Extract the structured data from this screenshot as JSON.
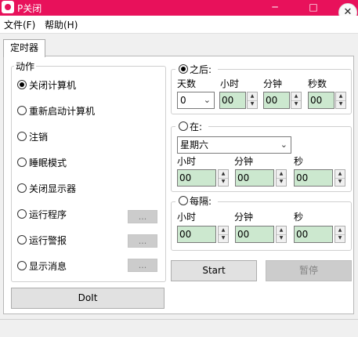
{
  "window": {
    "title": "P关闭",
    "min_glyph": "─",
    "max_glyph": "□",
    "close_glyph": "✕"
  },
  "menu": {
    "file": "文件(F)",
    "help": "帮助(H)"
  },
  "tab": {
    "label": "定时器"
  },
  "actions": {
    "label": "动作",
    "items": [
      "关闭计算机",
      "重新启动计算机",
      "注销",
      "睡眠模式",
      "关闭显示器",
      "运行程序",
      "运行警报",
      "显示消息"
    ],
    "selected": "关闭计算机",
    "dots": "..."
  },
  "after": {
    "label": "之后:",
    "checked": true,
    "days_label": "天数",
    "hours_label": "小时",
    "minutes_label": "分钟",
    "seconds_label": "秒数",
    "days": "0",
    "hours": "00",
    "minutes": "00",
    "seconds": "00"
  },
  "at": {
    "label": "在:",
    "checked": false,
    "weekday": "星期六",
    "hours_label": "小时",
    "minutes_label": "分钟",
    "seconds_label": "秒",
    "hours": "00",
    "minutes": "00",
    "seconds": "00"
  },
  "every": {
    "label": "每隔:",
    "checked": false,
    "hours_label": "小时",
    "minutes_label": "分钟",
    "seconds_label": "秒",
    "hours": "00",
    "minutes": "00",
    "seconds": "00"
  },
  "buttons": {
    "start": "Start",
    "pause": "暂停",
    "doit": "DoIt"
  },
  "colors": {
    "titlebar": "#e8115b",
    "field_bg": "#cce8cf",
    "disabled_button": "#cccccc"
  }
}
